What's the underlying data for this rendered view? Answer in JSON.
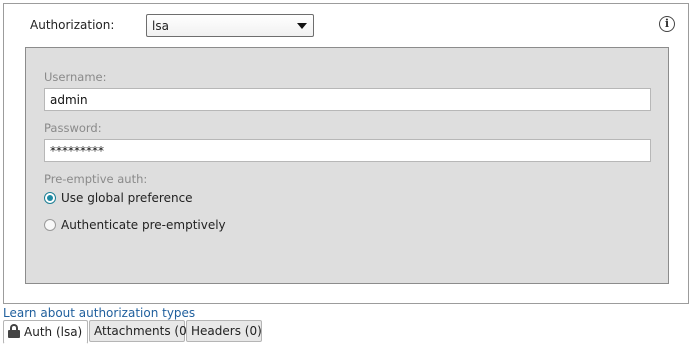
{
  "auth": {
    "label": "Authorization:",
    "selected": "lsa",
    "info_icon_glyph": "i"
  },
  "form": {
    "username_label": "Username:",
    "username_value": "admin",
    "password_label": "Password:",
    "password_value": "*********",
    "preemptive_label": "Pre-emptive auth:",
    "options": [
      {
        "label": "Use global preference",
        "selected": true
      },
      {
        "label": "Authenticate pre-emptively",
        "selected": false
      }
    ]
  },
  "link": {
    "learn": "Learn about authorization types"
  },
  "tabs": [
    {
      "label": "Auth (lsa)",
      "icon": "lock-icon",
      "active": true
    },
    {
      "label": "Attachments (0)",
      "active": false
    },
    {
      "label": "Headers (0)",
      "active": false
    }
  ],
  "colors": {
    "radio_accent": "#1f8aa3",
    "link": "#1f5f9d",
    "inner_panel_bg": "#dedede"
  }
}
